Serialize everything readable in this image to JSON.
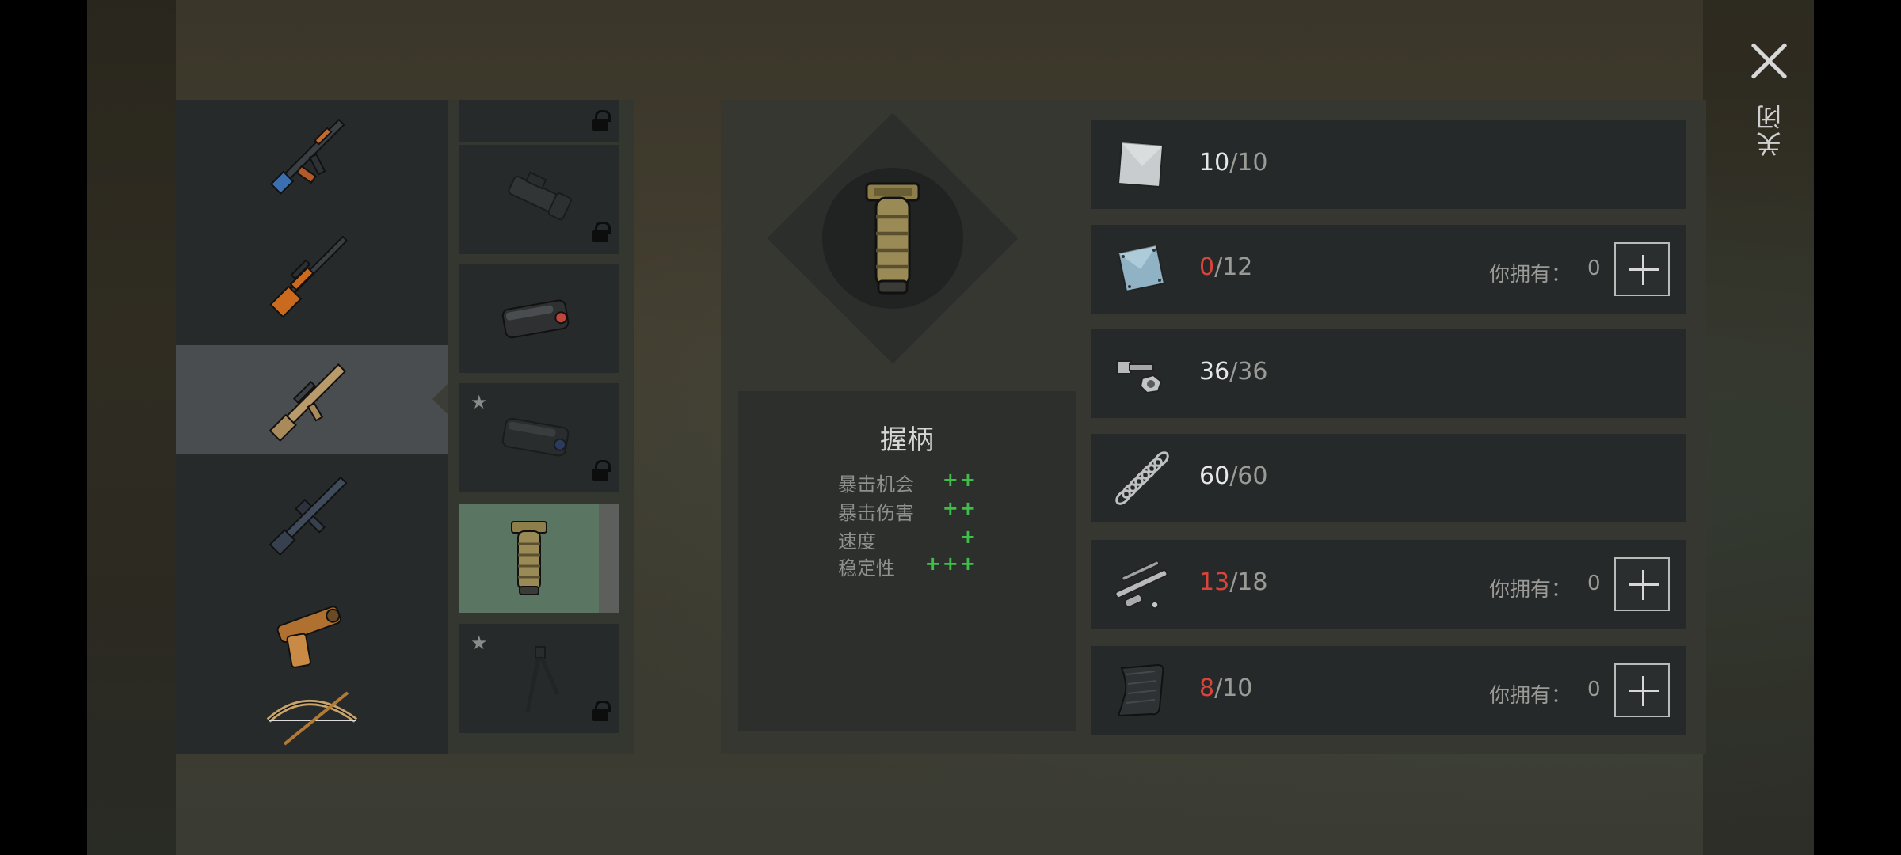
{
  "close": {
    "label": "关闭"
  },
  "weapons": [
    {
      "name": "AK rifle",
      "icon": "ak-rifle-icon",
      "selected": false
    },
    {
      "name": "SVD rifle",
      "icon": "sniper-rifle-icon",
      "selected": false
    },
    {
      "name": "SCAR rifle",
      "icon": "scar-rifle-icon",
      "selected": true
    },
    {
      "name": "M16 rifle",
      "icon": "m16-rifle-icon",
      "selected": false
    },
    {
      "name": "Pistol",
      "icon": "pistol-icon",
      "selected": false
    },
    {
      "name": "Bow",
      "icon": "bow-icon",
      "selected": false
    }
  ],
  "attachments": [
    {
      "icon": "attachment-icon",
      "locked": true,
      "starred": false
    },
    {
      "icon": "flashlight-icon",
      "locked": true,
      "starred": false
    },
    {
      "icon": "laser-sight-icon",
      "locked": false,
      "starred": false
    },
    {
      "icon": "laser-sight-icon",
      "locked": true,
      "starred": true
    },
    {
      "icon": "grip-icon",
      "locked": false,
      "starred": false,
      "selected": true
    },
    {
      "icon": "bipod-icon",
      "locked": true,
      "starred": true
    }
  ],
  "item": {
    "title": "握柄",
    "stats": [
      {
        "label": "暴击机会",
        "value": "++"
      },
      {
        "label": "暴击伤害",
        "value": "++"
      },
      {
        "label": "速度",
        "value": "+"
      },
      {
        "label": "稳定性",
        "value": "+++"
      }
    ]
  },
  "owned_label": "你拥有：",
  "resources": [
    {
      "icon": "steel-plate-icon",
      "current": "10",
      "required": "/10",
      "short": false,
      "owned": null
    },
    {
      "icon": "blue-plate-icon",
      "current": "0",
      "required": "/12",
      "short": true,
      "owned": "0"
    },
    {
      "icon": "bolts-nuts-icon",
      "current": "36",
      "required": "/36",
      "short": false,
      "owned": null
    },
    {
      "icon": "spring-icon",
      "current": "60",
      "required": "/60",
      "short": false,
      "owned": null
    },
    {
      "icon": "gun-parts-icon",
      "current": "13",
      "required": "/18",
      "short": true,
      "owned": "0"
    },
    {
      "icon": "carbon-fabric-icon",
      "current": "8",
      "required": "/10",
      "short": true,
      "owned": "0"
    }
  ],
  "colors": {
    "short": "#d9443a",
    "bonus": "#3fbf4a",
    "selected_slot": "#5b7563"
  }
}
